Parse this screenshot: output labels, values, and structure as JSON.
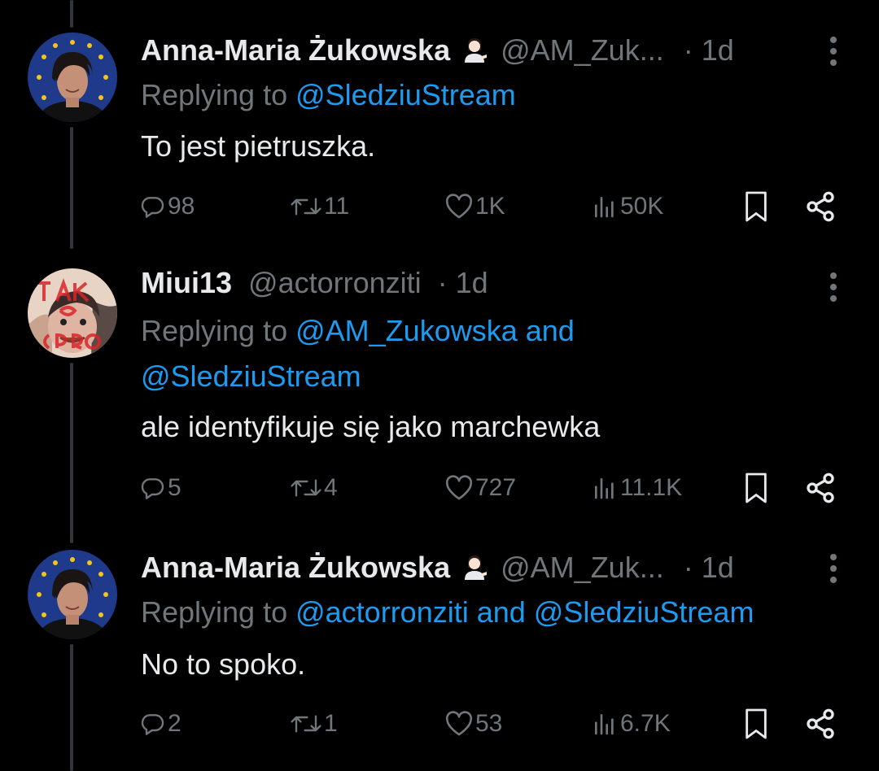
{
  "tweets": [
    {
      "name": "Anna-Maria Żukowska",
      "handle": "@AM_Zuk...",
      "time": "· 1d",
      "reply_prefix": "Replying to ",
      "reply_lines": [
        "@SledziuStream"
      ],
      "text": "To jest pietruszka.",
      "replies": "98",
      "retweets": "11",
      "likes": "1K",
      "views": "50K"
    },
    {
      "name": "Miui13",
      "handle": "@actorronziti",
      "time": "· 1d",
      "reply_prefix": "Replying to ",
      "reply_lines": [
        "@AM_Zukowska and",
        "@SledziuStream"
      ],
      "text": "ale identyfikuje się jako marchewka",
      "replies": "5",
      "retweets": "4",
      "likes": "727",
      "views": "11.1K"
    },
    {
      "name": "Anna-Maria Żukowska",
      "handle": "@AM_Zuk...",
      "time": "· 1d",
      "reply_prefix": "Replying to ",
      "reply_lines": [
        "@actorronziti and @SledziuStream"
      ],
      "text": "No to spoko.",
      "replies": "2",
      "retweets": "1",
      "likes": "53",
      "views": "6.7K"
    }
  ],
  "colors": {
    "background": "#000000",
    "text": "#e7e9ea",
    "muted": "#71767b",
    "link": "#1d9bf0",
    "thread": "#333639"
  },
  "icons": [
    "reply-icon",
    "retweet-icon",
    "like-icon",
    "views-icon",
    "bookmark-icon",
    "share-icon",
    "more-icon",
    "info-emoji-icon"
  ]
}
